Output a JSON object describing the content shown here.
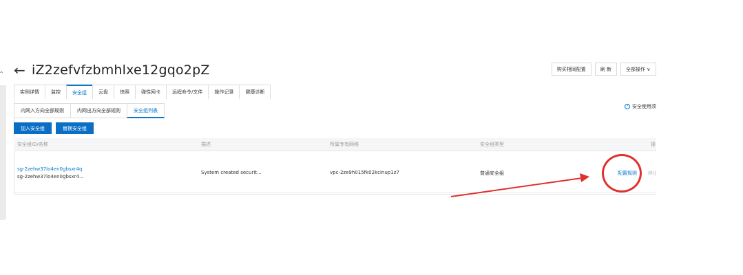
{
  "header": {
    "back_glyph": "←",
    "title": "iZ2zefvfzbmhlxe12gqo2pZ",
    "actions": [
      "购买相同配置",
      "刷 新",
      "全部操作 ∨"
    ]
  },
  "tabs": [
    "实例详情",
    "监控",
    "安全组",
    "云盘",
    "快照",
    "弹性网卡",
    "远程命令/文件",
    "操作记录",
    "健康诊断"
  ],
  "active_tab_index": 2,
  "subtabs": [
    "内网入方向全部规则",
    "内网出方向全部规则",
    "安全组列表"
  ],
  "active_subtab_index": 2,
  "help_text": "安全使用须",
  "buttons": {
    "join": "加入安全组",
    "replace": "替换安全组"
  },
  "table": {
    "headers": [
      "安全组ID/名称",
      "描述",
      "所属专有网络",
      "安全组类型",
      "操"
    ],
    "rows": [
      {
        "id": "sg-2zehw37lo4en0gbsxr4q",
        "name": "sg-2zehw37lo4en0gbsxr4...",
        "description": "System created securit...",
        "vpc": "vpc-2ze9h015fk02kcinup1z7",
        "type": "普通安全组",
        "action_configure": "配置规则",
        "action_remove": "移出"
      }
    ]
  },
  "annotation_color": "#e0302d",
  "accent_color": "#0a78c8"
}
